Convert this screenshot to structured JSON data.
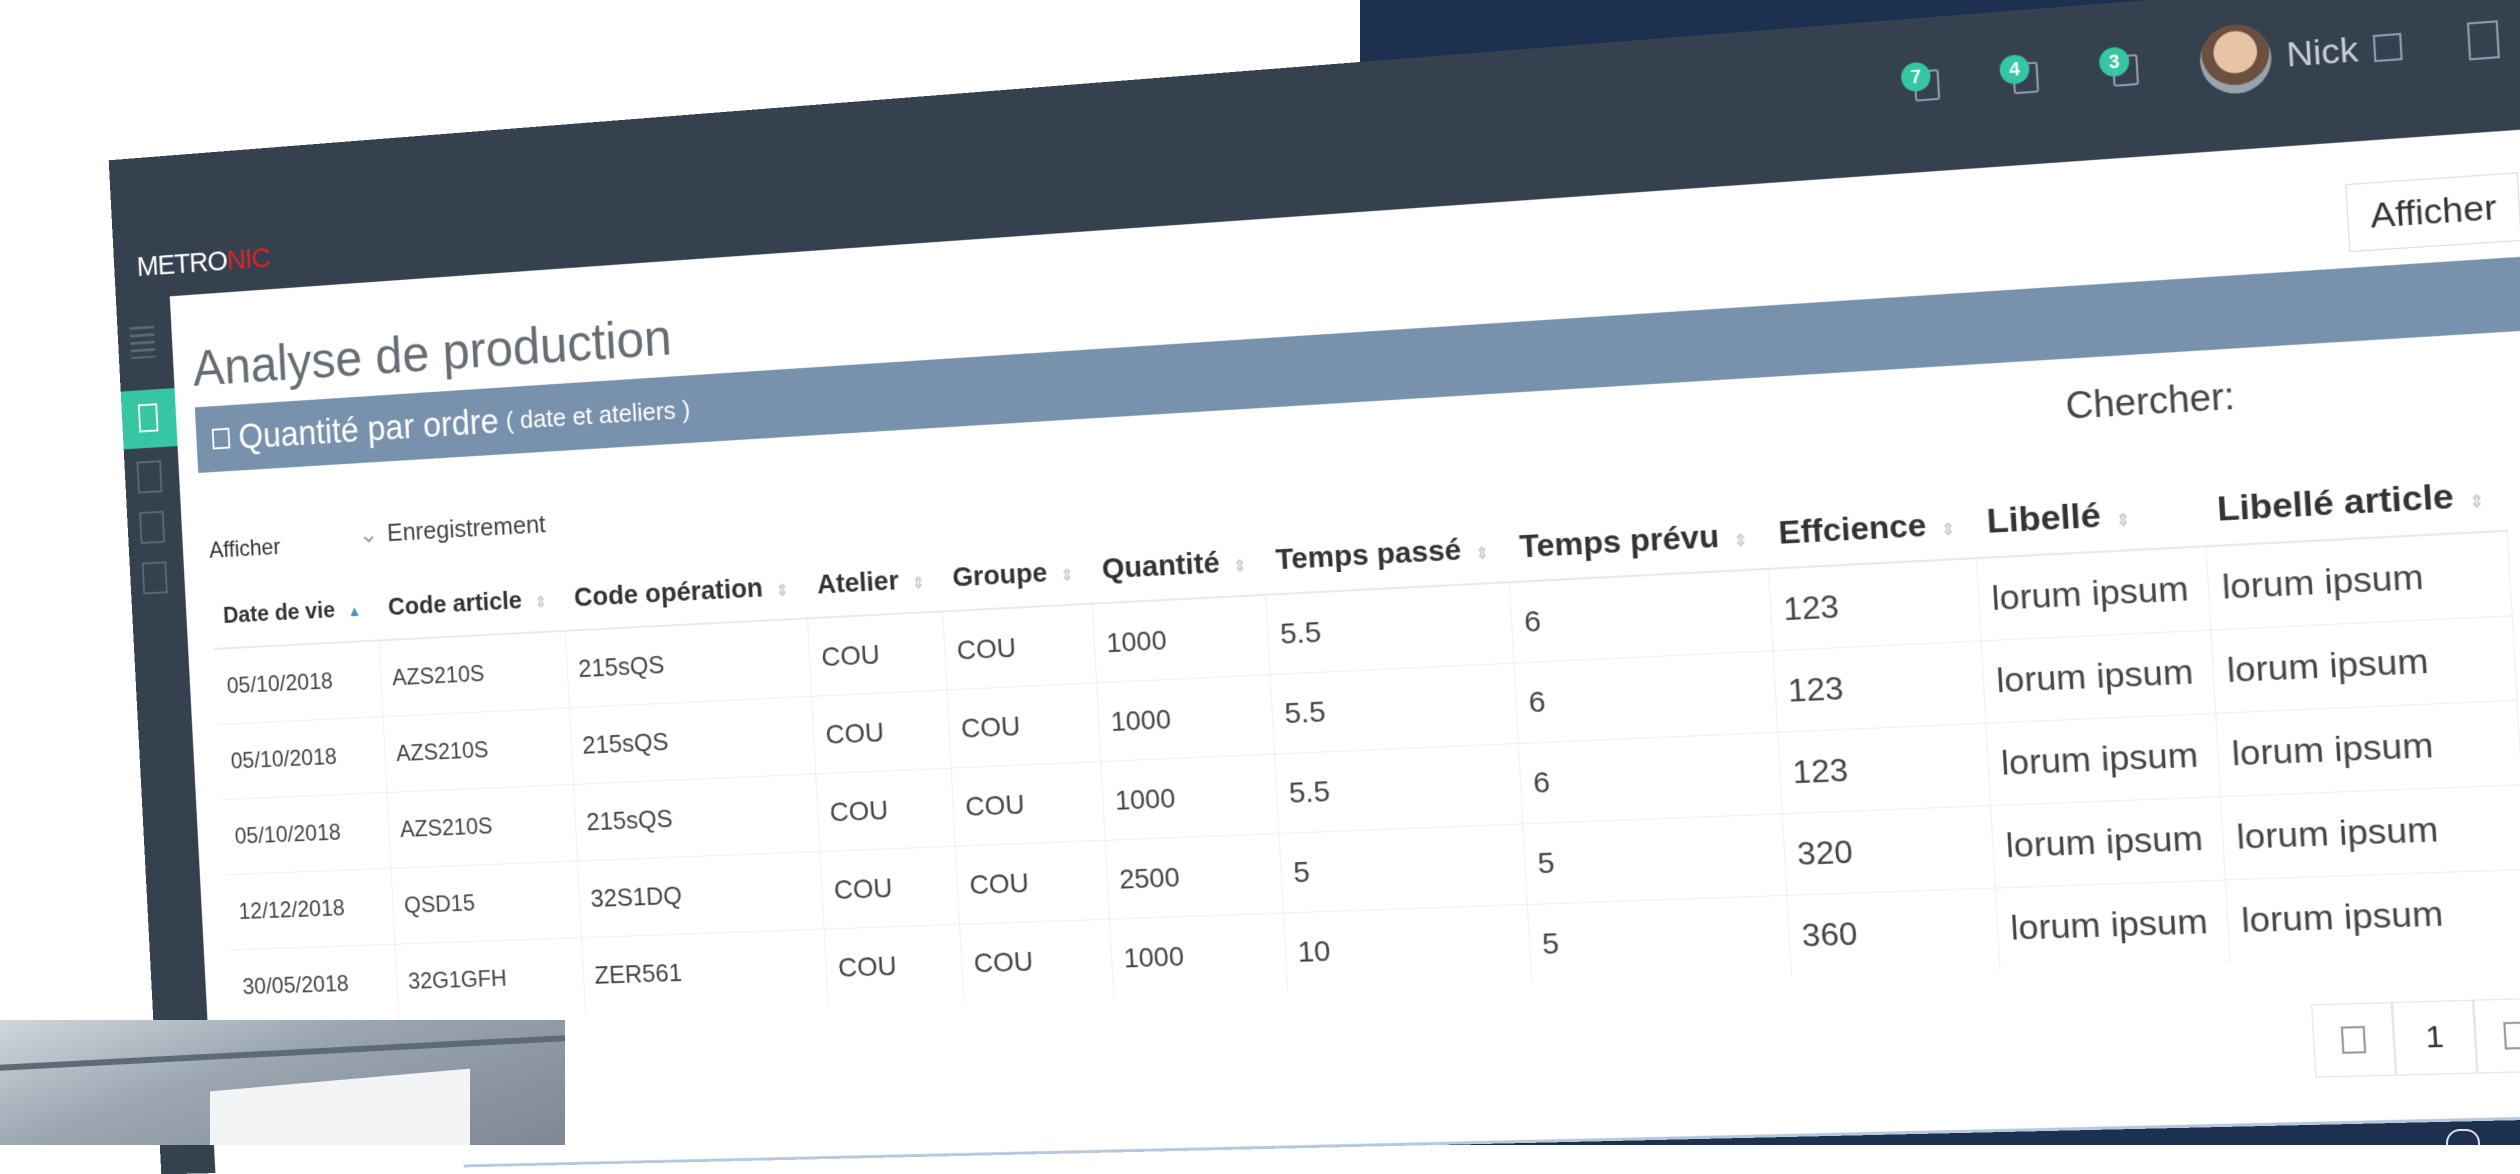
{
  "app": {
    "logo_main": "METRO",
    "logo_accent": "NIC"
  },
  "header": {
    "notifications": [
      {
        "count": "7",
        "icon": "bell-icon"
      },
      {
        "count": "4",
        "icon": "envelope-icon"
      },
      {
        "count": "3",
        "icon": "calendar-icon"
      }
    ],
    "user": {
      "name": "Nick"
    }
  },
  "page": {
    "title": "Analyse de production",
    "afficher_button": "Afficher"
  },
  "portlet": {
    "title": "Quantité par ordre",
    "subtitle": "( date et ateliers )"
  },
  "table_controls": {
    "length_label": "Afficher",
    "length_select": "Enregistrement",
    "search_label": "Chercher:"
  },
  "table": {
    "columns": [
      "Date de vie",
      "Code article",
      "Code opération",
      "Atelier",
      "Groupe",
      "Quantité",
      "Temps passé",
      "Temps prévu",
      "Effcience",
      "Libellé",
      "Libellé article"
    ],
    "rows": [
      [
        "05/10/2018",
        "AZS210S",
        "215sQS",
        "COU",
        "COU",
        "1000",
        "5.5",
        "6",
        "123",
        "lorum ipsum",
        "lorum ipsum"
      ],
      [
        "05/10/2018",
        "AZS210S",
        "215sQS",
        "COU",
        "COU",
        "1000",
        "5.5",
        "6",
        "123",
        "lorum ipsum",
        "lorum ipsum"
      ],
      [
        "05/10/2018",
        "AZS210S",
        "215sQS",
        "COU",
        "COU",
        "1000",
        "5.5",
        "6",
        "123",
        "lorum ipsum",
        "lorum ipsum"
      ],
      [
        "12/12/2018",
        "QSD15",
        "32S1DQ",
        "COU",
        "COU",
        "2500",
        "5",
        "5",
        "320",
        "lorum ipsum",
        "lorum ipsum"
      ],
      [
        "30/05/2018",
        "32G1GFH",
        "ZER561",
        "COU",
        "COU",
        "1000",
        "10",
        "5",
        "360",
        "lorum ipsum",
        "lorum ipsum"
      ]
    ]
  },
  "pagination": {
    "current": "1"
  },
  "colors": {
    "header": "#364150",
    "accent": "#36c6a3",
    "portlet": "#7891ad",
    "logo_red": "#e02222",
    "background": "#1e3050"
  }
}
